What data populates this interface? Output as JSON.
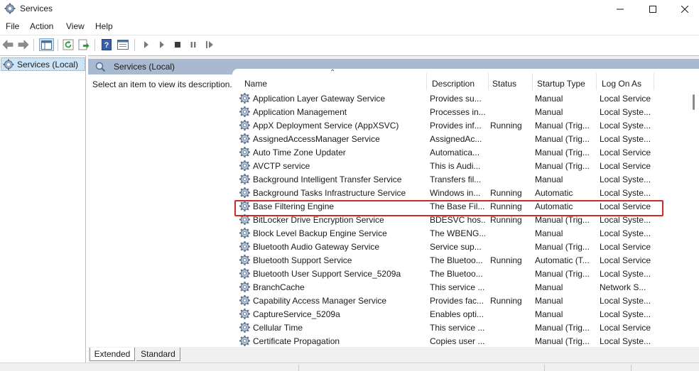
{
  "window": {
    "title": "Services",
    "icon": "gear-icon"
  },
  "menu": [
    "File",
    "Action",
    "View",
    "Help"
  ],
  "toolbar": {
    "buttons": [
      "back-arrow-icon",
      "forward-arrow-icon",
      "show-hide-console-tree-icon",
      "refresh-icon",
      "export-list-icon",
      "help-icon",
      "properties-icon",
      "start-service-icon",
      "start-service-alt-icon",
      "stop-service-icon",
      "pause-service-icon",
      "restart-service-icon"
    ]
  },
  "tree": {
    "node_label": "Services (Local)"
  },
  "panel": {
    "header": "Services (Local)",
    "description_prompt": "Select an item to view its description."
  },
  "columns": {
    "name": "Name",
    "description": "Description",
    "status": "Status",
    "startup": "Startup Type",
    "logon": "Log On As"
  },
  "services": [
    {
      "name": "Application Layer Gateway Service",
      "description": "Provides su...",
      "status": "",
      "startup": "Manual",
      "logon": "Local Service"
    },
    {
      "name": "Application Management",
      "description": "Processes in...",
      "status": "",
      "startup": "Manual",
      "logon": "Local Syste..."
    },
    {
      "name": "AppX Deployment Service (AppXSVC)",
      "description": "Provides inf...",
      "status": "Running",
      "startup": "Manual (Trig...",
      "logon": "Local Syste..."
    },
    {
      "name": "AssignedAccessManager Service",
      "description": "AssignedAc...",
      "status": "",
      "startup": "Manual (Trig...",
      "logon": "Local Syste..."
    },
    {
      "name": "Auto Time Zone Updater",
      "description": "Automatica...",
      "status": "",
      "startup": "Manual (Trig...",
      "logon": "Local Service"
    },
    {
      "name": "AVCTP service",
      "description": "This is Audi...",
      "status": "",
      "startup": "Manual (Trig...",
      "logon": "Local Service"
    },
    {
      "name": "Background Intelligent Transfer Service",
      "description": "Transfers fil...",
      "status": "",
      "startup": "Manual",
      "logon": "Local Syste..."
    },
    {
      "name": "Background Tasks Infrastructure Service",
      "description": "Windows in...",
      "status": "Running",
      "startup": "Automatic",
      "logon": "Local Syste..."
    },
    {
      "name": "Base Filtering Engine",
      "description": "The Base Fil...",
      "status": "Running",
      "startup": "Automatic",
      "logon": "Local Service"
    },
    {
      "name": "BitLocker Drive Encryption Service",
      "description": "BDESVC hos...",
      "status": "Running",
      "startup": "Manual (Trig...",
      "logon": "Local Syste..."
    },
    {
      "name": "Block Level Backup Engine Service",
      "description": "The WBENG...",
      "status": "",
      "startup": "Manual",
      "logon": "Local Syste..."
    },
    {
      "name": "Bluetooth Audio Gateway Service",
      "description": "Service sup...",
      "status": "",
      "startup": "Manual (Trig...",
      "logon": "Local Service"
    },
    {
      "name": "Bluetooth Support Service",
      "description": "The Bluetoo...",
      "status": "Running",
      "startup": "Automatic (T...",
      "logon": "Local Service"
    },
    {
      "name": "Bluetooth User Support Service_5209a",
      "description": "The Bluetoo...",
      "status": "",
      "startup": "Manual (Trig...",
      "logon": "Local Syste..."
    },
    {
      "name": "BranchCache",
      "description": "This service ...",
      "status": "",
      "startup": "Manual",
      "logon": "Network S..."
    },
    {
      "name": "Capability Access Manager Service",
      "description": "Provides fac...",
      "status": "Running",
      "startup": "Manual",
      "logon": "Local Syste..."
    },
    {
      "name": "CaptureService_5209a",
      "description": "Enables opti...",
      "status": "",
      "startup": "Manual",
      "logon": "Local Syste..."
    },
    {
      "name": "Cellular Time",
      "description": "This service ...",
      "status": "",
      "startup": "Manual (Trig...",
      "logon": "Local Service"
    },
    {
      "name": "Certificate Propagation",
      "description": "Copies user ...",
      "status": "",
      "startup": "Manual (Trig...",
      "logon": "Local Syste..."
    }
  ],
  "highlighted_service": "BitLocker Drive Encryption Service",
  "highlight_color": "#cf2a2a",
  "tabs": [
    "Extended",
    "Standard"
  ],
  "selected_tab": "Extended"
}
